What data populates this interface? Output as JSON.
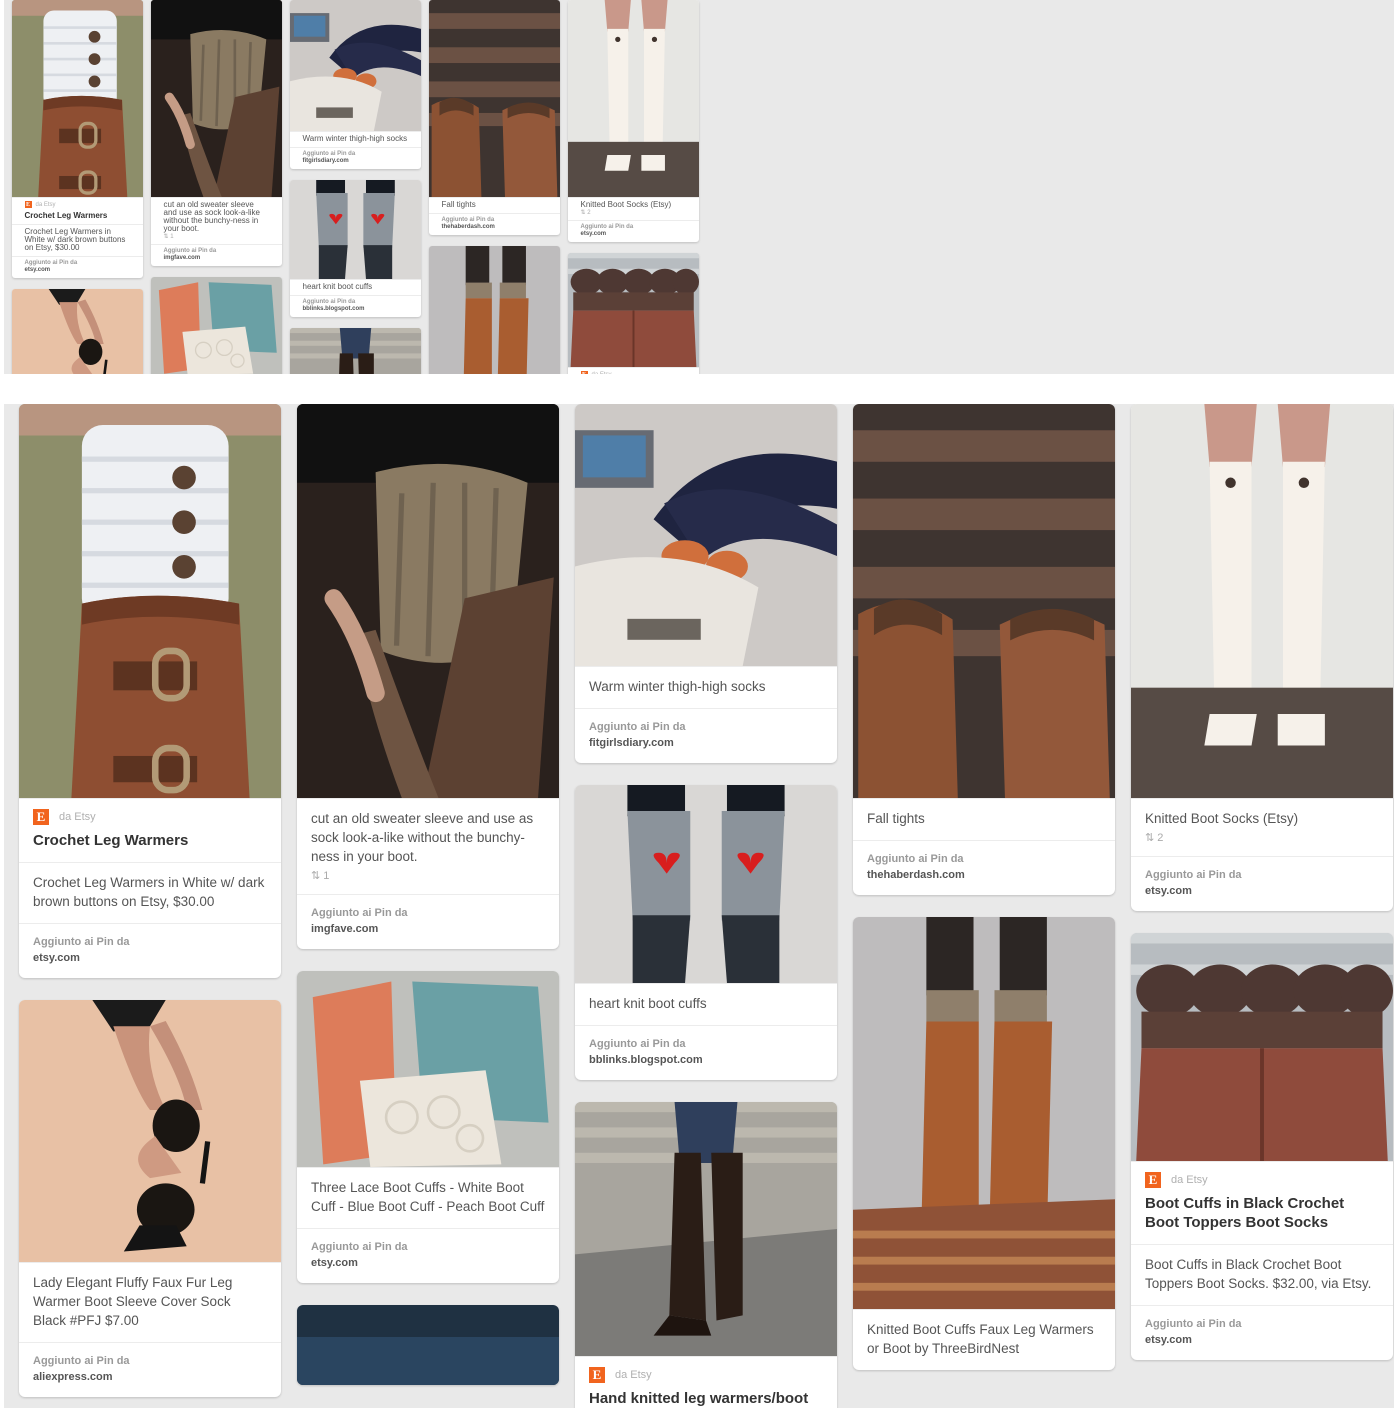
{
  "pins": [
    {
      "id": "crochet-leg-warmers",
      "source": "da Etsy",
      "title": "Crochet Leg Warmers",
      "description": "Crochet Leg Warmers in White w/ dark brown buttons on Etsy, $30.00",
      "added_label": "Aggiunto ai Pin da",
      "domain": "etsy.com"
    },
    {
      "id": "fluffy-faux-fur",
      "description": "Lady Elegant Fluffy Faux Fur Leg Warmer Boot Sleeve Cover Sock Black #PFJ $7.00",
      "added_label": "Aggiunto ai Pin da",
      "domain": "aliexpress.com"
    },
    {
      "id": "sweater-sleeve",
      "description": "cut an old sweater sleeve and use as sock look-a-like without the bunchy-ness in your boot.",
      "repins": "1",
      "added_label": "Aggiunto ai Pin da",
      "domain": "imgfave.com"
    },
    {
      "id": "three-lace",
      "description": "Three Lace Boot Cuffs - White Boot Cuff - Blue Boot Cuff - Peach Boot Cuff",
      "added_label": "Aggiunto ai Pin da",
      "domain": "etsy.com"
    },
    {
      "id": "thigh-high",
      "description": "Warm winter thigh-high socks",
      "added_label": "Aggiunto ai Pin da",
      "domain": "fitgirlsdiary.com"
    },
    {
      "id": "heart-knit",
      "description": "heart knit boot cuffs",
      "added_label": "Aggiunto ai Pin da",
      "domain": "bblinks.blogspot.com"
    },
    {
      "id": "hand-knitted",
      "source": "da Etsy",
      "title": "Hand knitted leg warmers/boot"
    },
    {
      "id": "fall-tights",
      "description": "Fall tights",
      "added_label": "Aggiunto ai Pin da",
      "domain": "thehaberdash.com"
    },
    {
      "id": "knitted-faux-leg",
      "description": "Knitted Boot Cuffs Faux Leg Warmers or Boot by ThreeBirdNest"
    },
    {
      "id": "knitted-boot-socks",
      "description": "Knitted Boot Socks (Etsy)",
      "repins": "2",
      "added_label": "Aggiunto ai Pin da",
      "domain": "etsy.com"
    },
    {
      "id": "black-crochet",
      "source": "da Etsy",
      "title": "Boot Cuffs in Black Crochet Boot Toppers Boot Socks",
      "description": "Boot Cuffs in Black Crochet Boot Toppers Boot Socks. $32.00, via Etsy.",
      "added_label": "Aggiunto ai Pin da",
      "domain": "etsy.com"
    }
  ],
  "icons": {
    "etsy": "etsy-e-icon",
    "repin": "repin-icon"
  },
  "colors": {
    "etsy": "#f1641e",
    "background": "#e9e9e9",
    "card": "#ffffff"
  }
}
